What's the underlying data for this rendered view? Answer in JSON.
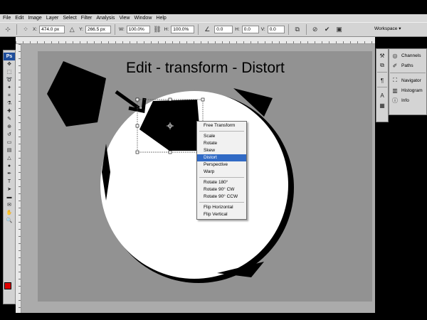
{
  "menu": [
    "File",
    "Edit",
    "Image",
    "Layer",
    "Select",
    "Filter",
    "Analysis",
    "View",
    "Window",
    "Help"
  ],
  "options": {
    "x_label": "X:",
    "x_value": "474.0 px",
    "y_label": "Y:",
    "y_value": "266.5 px",
    "w_label": "W:",
    "w_value": "100.0%",
    "h_label": "H:",
    "h_value": "100.0%",
    "angle_value": "0.0",
    "hskew_label": "H:",
    "hskew_value": "0.0",
    "vskew_label": "V:",
    "vskew_value": "0.0",
    "workspace_label": "Workspace ▾"
  },
  "canvas": {
    "title": "Edit - transform - Distort",
    "colors": {
      "canvas_bg": "#929292",
      "ball": "#ffffff",
      "shape": "#000000",
      "fg_swatch": "#e00000"
    }
  },
  "context_menu": {
    "items": [
      "Free Transform",
      "Scale",
      "Rotate",
      "Skew",
      "Distort",
      "Perspective",
      "Warp",
      "Rotate 180°",
      "Rotate 90° CW",
      "Rotate 90° CCW",
      "Flip Horizontal",
      "Flip Vertical"
    ],
    "selected": "Distort"
  },
  "panels": {
    "group1": [
      "Channels",
      "Paths"
    ],
    "group2": [
      "Navigator",
      "Histogram",
      "Info"
    ]
  },
  "tools_logo": "Ps"
}
